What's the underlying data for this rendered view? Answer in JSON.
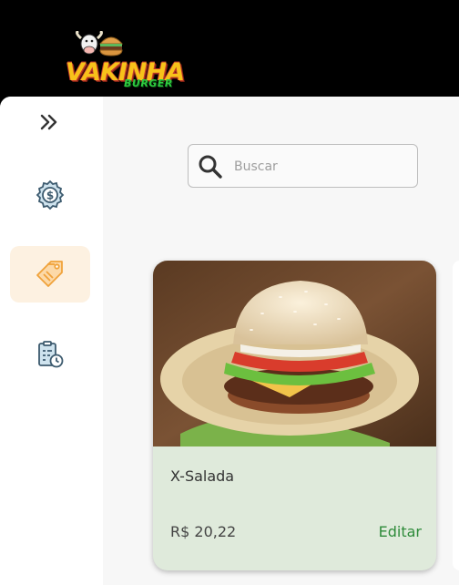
{
  "header": {
    "logo_text": "VAKINHA",
    "logo_subtext": "BURGER"
  },
  "sidebar": {
    "expand_icon": "chevrons-right-icon",
    "items": [
      {
        "icon": "payment-gear-icon",
        "active": false
      },
      {
        "icon": "product-tag-icon",
        "active": true
      },
      {
        "icon": "order-history-icon",
        "active": false
      }
    ],
    "active_color": "#fdf1e1"
  },
  "search": {
    "placeholder": "Buscar",
    "value": ""
  },
  "products": [
    {
      "name": "X-Salada",
      "price": "R$ 20,22",
      "edit_label": "Editar",
      "image": "burger-photo"
    }
  ],
  "colors": {
    "card_background": "#dfeadb",
    "edit_link": "#2e8b3a",
    "logo_yellow": "#f7c21a",
    "logo_green": "#2ecc40"
  }
}
